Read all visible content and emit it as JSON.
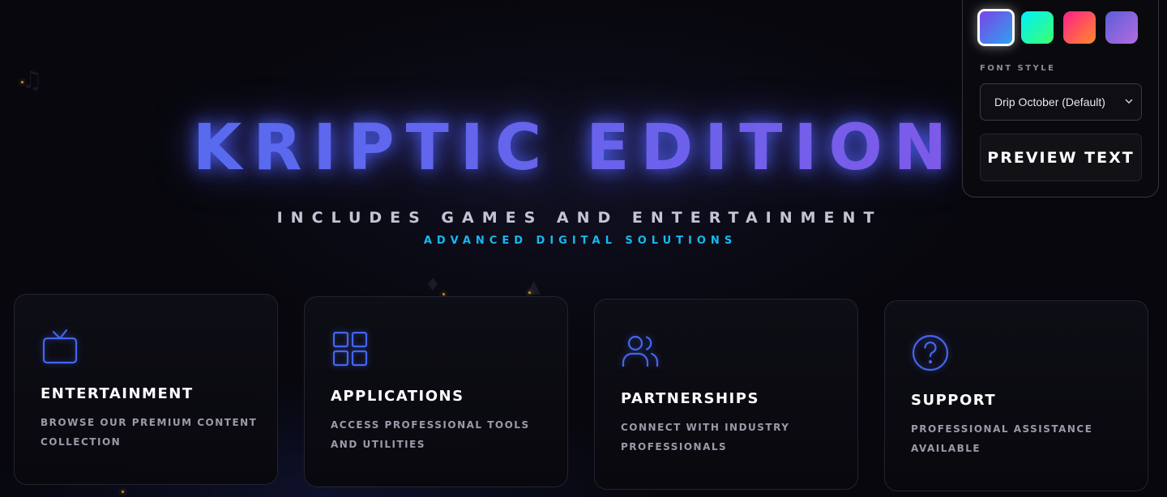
{
  "hero": {
    "title": "Kriptic Edition",
    "subtitle": "Includes Games and Entertainment",
    "tagline": "Advanced Digital Solutions"
  },
  "cards": [
    {
      "icon": "tv-icon",
      "title": "Entertainment",
      "description": "Browse our premium content collection"
    },
    {
      "icon": "grid-icon",
      "title": "Applications",
      "description": "Access professional tools and utilities"
    },
    {
      "icon": "users-icon",
      "title": "Partnerships",
      "description": "Connect with industry professionals"
    },
    {
      "icon": "help-circle-icon",
      "title": "Support",
      "description": "Professional assistance available"
    }
  ],
  "settings": {
    "themes": [
      {
        "name": "theme-blue-purple",
        "from": "#6a4de6",
        "to": "#2fa0f0",
        "selected": true
      },
      {
        "name": "theme-cyan-green",
        "from": "#00ffd5",
        "to": "#3cff6a",
        "selected": false
      },
      {
        "name": "theme-pink-orange",
        "from": "#ff1f6e",
        "to": "#ff7a2a",
        "selected": false
      },
      {
        "name": "theme-violet",
        "from": "#5b5ed8",
        "to": "#b56be0",
        "selected": false
      }
    ],
    "font_style_label": "Font Style",
    "font_style_value": "Drip October (Default)",
    "preview_text": "Preview Text"
  },
  "colors": {
    "accent": "#4466ee",
    "tagline": "#16b9ef",
    "background": "#07070d"
  }
}
